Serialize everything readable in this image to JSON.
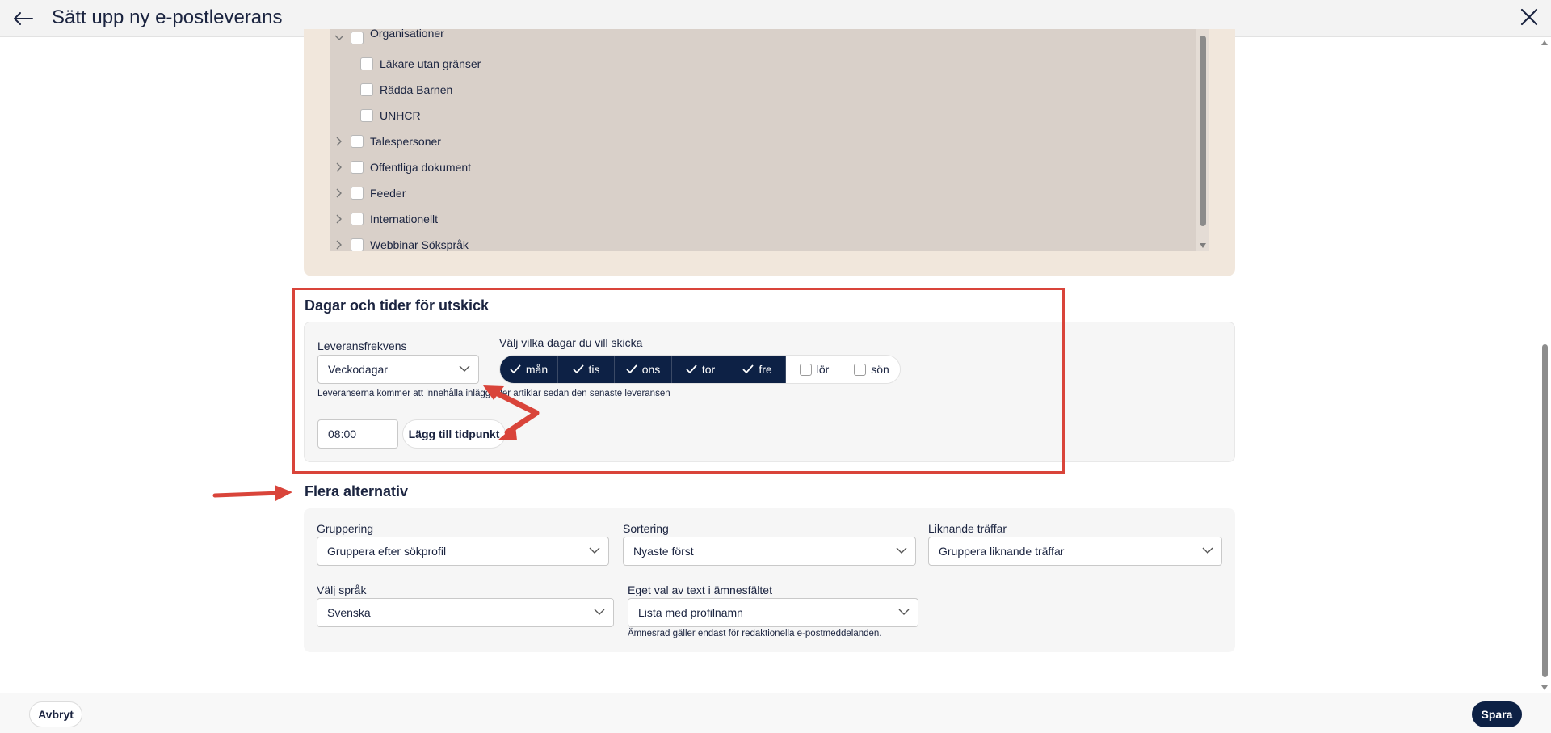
{
  "header": {
    "title": "Sätt upp ny e-postleverans",
    "back_icon": "arrow-left-icon",
    "close_icon": "close-icon"
  },
  "tree": {
    "items": [
      {
        "label": "Organisationer",
        "expandable": true,
        "expanded": true,
        "level": 0
      },
      {
        "label": "Läkare utan gränser",
        "expandable": false,
        "level": 1
      },
      {
        "label": "Rädda Barnen",
        "expandable": false,
        "level": 1
      },
      {
        "label": "UNHCR",
        "expandable": false,
        "level": 1
      },
      {
        "label": "Talespersoner",
        "expandable": true,
        "expanded": false,
        "level": 0
      },
      {
        "label": "Offentliga dokument",
        "expandable": true,
        "expanded": false,
        "level": 0
      },
      {
        "label": "Feeder",
        "expandable": true,
        "expanded": false,
        "level": 0
      },
      {
        "label": "Internationellt",
        "expandable": true,
        "expanded": false,
        "level": 0
      },
      {
        "label": "Webbinar Sökspråk",
        "expandable": true,
        "expanded": false,
        "level": 0
      }
    ]
  },
  "schedule": {
    "title": "Dagar och tider för utskick",
    "frequency_label": "Leveransfrekvens",
    "frequency_value": "Veckodagar",
    "frequency_help": "Leveranserna kommer att innehålla inlägg eller artiklar sedan den senaste leveransen",
    "days_label": "Välj vilka dagar du vill skicka",
    "days": [
      {
        "label": "mån",
        "selected": true
      },
      {
        "label": "tis",
        "selected": true
      },
      {
        "label": "ons",
        "selected": true
      },
      {
        "label": "tor",
        "selected": true
      },
      {
        "label": "fre",
        "selected": true
      },
      {
        "label": "lör",
        "selected": false
      },
      {
        "label": "sön",
        "selected": false
      }
    ],
    "time_value": "08:00",
    "add_time_label": "Lägg till tidpunkt"
  },
  "more_options": {
    "title": "Flera alternativ",
    "grouping_label": "Gruppering",
    "grouping_value": "Gruppera efter sökprofil",
    "sorting_label": "Sortering",
    "sorting_value": "Nyaste först",
    "similar_label": "Liknande träffar",
    "similar_value": "Gruppera liknande träffar",
    "language_label": "Välj språk",
    "language_value": "Svenska",
    "subject_label": "Eget val av text i ämnesfältet",
    "subject_value": "Lista med profilnamn",
    "subject_help": "Ämnesrad gäller endast för redaktionella e-postmeddelanden."
  },
  "footer": {
    "cancel_label": "Avbryt",
    "save_label": "Spara"
  },
  "colors": {
    "primary": "#0d2145",
    "tree_bg": "#d9d0c9",
    "tree_outer": "#f1e7dc",
    "highlight": "#d9443a"
  }
}
